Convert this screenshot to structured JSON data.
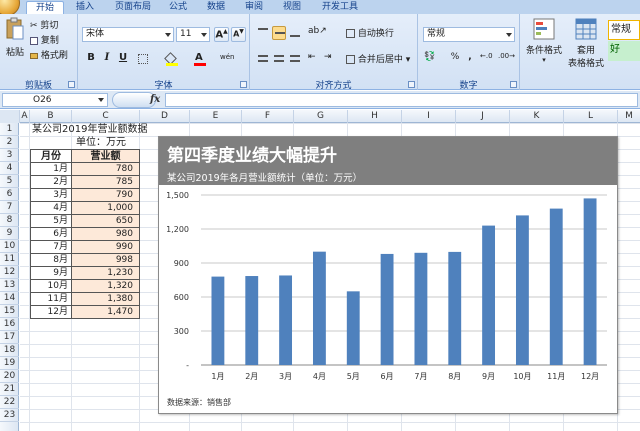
{
  "tabs": [
    "开始",
    "插入",
    "页面布局",
    "公式",
    "数据",
    "审阅",
    "视图",
    "开发工具"
  ],
  "clipboard": {
    "paste": "粘贴",
    "cut": "剪切",
    "copy": "复制",
    "format_painter": "格式刷",
    "label": "剪贴板"
  },
  "font": {
    "name": "宋体",
    "size": "11",
    "grow": "A",
    "shrink": "A",
    "bold": "B",
    "italic": "I",
    "underline": "U",
    "color_letter": "A",
    "phonetic": "wén",
    "label": "字体"
  },
  "alignment": {
    "wrap": "自动换行",
    "merge": "合并后居中",
    "label": "对齐方式"
  },
  "number": {
    "format": "常规",
    "percent": "%",
    "comma": ",",
    "label": "数字"
  },
  "styles": {
    "conditional": "条件格式",
    "table_format_1": "套用",
    "table_format_2": "表格格式",
    "normal": "常规",
    "good": "好"
  },
  "colors": {
    "accent_bar": "#4f81bd",
    "banner": "#7f7f7f",
    "table_fill": "#fde9d9",
    "good_fill": "#c6efce",
    "good_text": "#006100"
  },
  "formula": {
    "name_box": "O26",
    "fx": "fx"
  },
  "columns": [
    "A",
    "B",
    "C",
    "D",
    "E",
    "F",
    "G",
    "H",
    "I",
    "J",
    "K",
    "L",
    "M"
  ],
  "rows": [
    "1",
    "2",
    "3",
    "4",
    "5",
    "6",
    "7",
    "8",
    "9",
    "10",
    "11",
    "12",
    "13",
    "14",
    "15",
    "16",
    "17",
    "18",
    "19",
    "20",
    "21",
    "22",
    "23"
  ],
  "sheet": {
    "title": "某公司2019年营业额数据",
    "unit": "单位：万元",
    "header_month": "月份",
    "header_revenue": "营业额",
    "table": [
      {
        "month": "1月",
        "value": "780"
      },
      {
        "month": "2月",
        "value": "785"
      },
      {
        "month": "3月",
        "value": "790"
      },
      {
        "month": "4月",
        "value": "1,000"
      },
      {
        "month": "5月",
        "value": "650"
      },
      {
        "month": "6月",
        "value": "980"
      },
      {
        "month": "7月",
        "value": "990"
      },
      {
        "month": "8月",
        "value": "998"
      },
      {
        "month": "9月",
        "value": "1,230"
      },
      {
        "month": "10月",
        "value": "1,320"
      },
      {
        "month": "11月",
        "value": "1,380"
      },
      {
        "month": "12月",
        "value": "1,470"
      }
    ]
  },
  "chart_data": {
    "type": "bar",
    "title": "第四季度业绩大幅提升",
    "subtitle": "某公司2019年各月营业额统计（单位：万元）",
    "source": "数据来源：销售部",
    "categories": [
      "1月",
      "2月",
      "3月",
      "4月",
      "5月",
      "6月",
      "7月",
      "8月",
      "9月",
      "10月",
      "11月",
      "12月"
    ],
    "values": [
      780,
      785,
      790,
      1000,
      650,
      980,
      990,
      998,
      1230,
      1320,
      1380,
      1470
    ],
    "ylim": [
      0,
      1500
    ],
    "yticks": [
      0,
      300,
      600,
      900,
      1200,
      1500
    ],
    "ytick_labels": [
      "-",
      "300",
      "600",
      "900",
      "1,200",
      "1,500"
    ],
    "grid": true,
    "bar_color": "#4f81bd"
  }
}
